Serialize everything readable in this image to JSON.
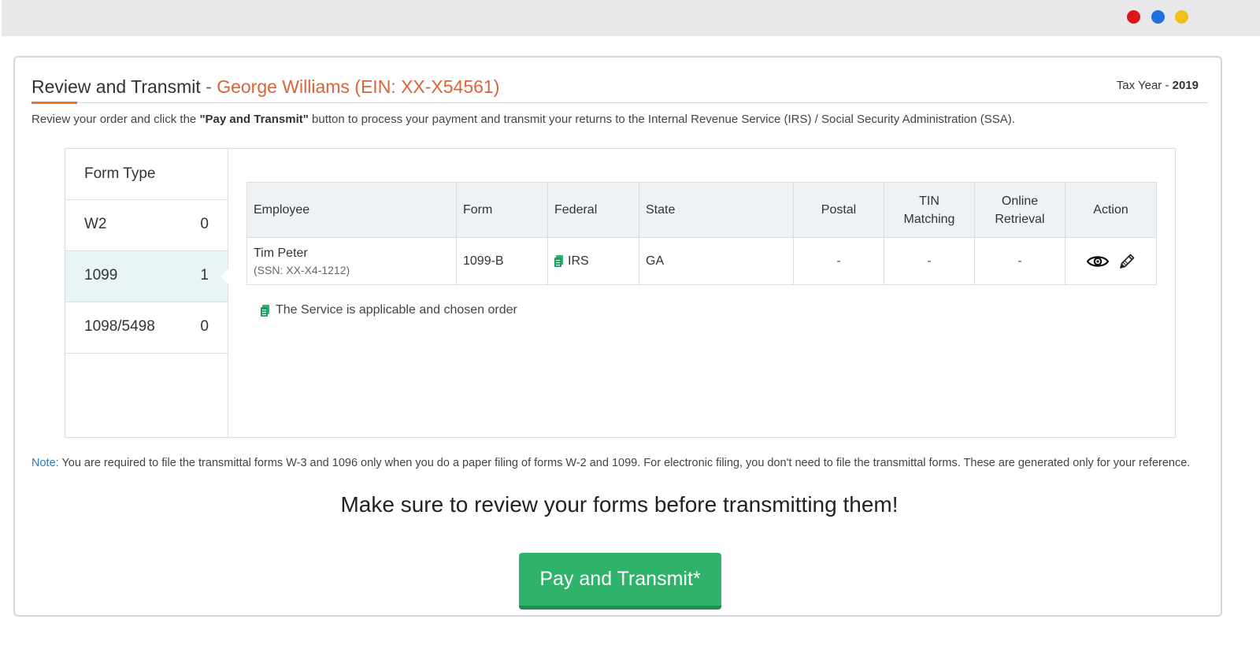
{
  "window_controls": {
    "colors": [
      "#e0141b",
      "#1f6fe0",
      "#f2c01c"
    ]
  },
  "header": {
    "title": "Review and Transmit",
    "separator": " - ",
    "client": "George Williams (EIN: XX-X54561)",
    "tax_year_label": "Tax Year - ",
    "tax_year": "2019"
  },
  "intro": {
    "before": "Review your order and click the ",
    "bold": "\"Pay and Transmit\"",
    "after": " button to process your payment and transmit your returns to the Internal Revenue Service (IRS) / Social Security Administration (SSA)."
  },
  "sidebar": {
    "heading": "Form Type",
    "items": [
      {
        "label": "W2",
        "count": "0"
      },
      {
        "label": "1099",
        "count": "1"
      },
      {
        "label": "1098/5498",
        "count": "0"
      }
    ]
  },
  "table": {
    "headers": {
      "employee": "Employee",
      "form": "Form",
      "federal": "Federal",
      "state": "State",
      "postal": "Postal",
      "tin_1": "TIN",
      "tin_2": "Matching",
      "online_1": "Online",
      "online_2": "Retrieval",
      "action": "Action"
    },
    "rows": [
      {
        "name": "Tim Peter",
        "ssn": "(SSN: XX-X4-1212)",
        "form": "1099-B",
        "federal": "IRS",
        "state": "GA",
        "postal": "-",
        "tin": "-",
        "online": "-"
      }
    ]
  },
  "legend": {
    "text": "The Service is applicable and chosen order"
  },
  "note": {
    "label": "Note:",
    "text": " You are required to file the transmittal forms W-3 and 1096 only when you do a paper filing of forms W-2 and 1099. For electronic filing, you don't need to file the transmittal forms. These are generated only for your reference."
  },
  "headline": "Make sure to review your forms before transmitting them!",
  "button": {
    "label": "Pay and Transmit*"
  },
  "icons": {
    "service": "document-icon",
    "view": "eye-icon",
    "edit": "pencil-icon"
  },
  "colors": {
    "accent": "#e8772f",
    "client": "#d9643a",
    "note_label": "#2b7bbf",
    "button": "#2fb36b",
    "service_icon": "#2bb673"
  }
}
